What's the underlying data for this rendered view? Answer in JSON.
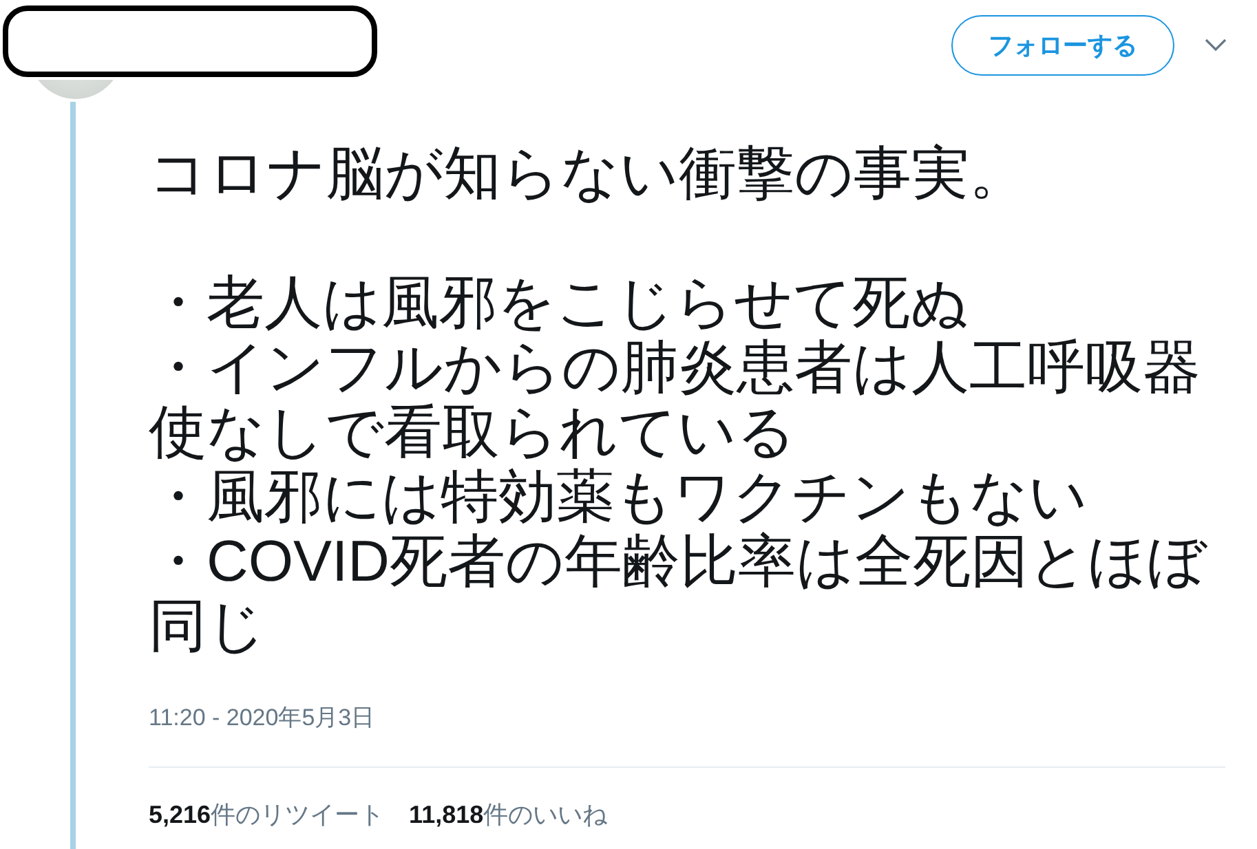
{
  "follow_button": {
    "label": "フォローする"
  },
  "tweet": {
    "headline": "コロナ脳が知らない衝撃の事実。",
    "points": [
      "・老人は風邪をこじらせて死ぬ",
      "・インフルからの肺炎患者は人工呼吸器使なしで看取られている",
      "・風邪には特効薬もワクチンもない",
      "・COVID死者の年齢比率は全死因とほぼ同じ"
    ],
    "timestamp": "11:20 - 2020年5月3日"
  },
  "stats": [
    {
      "text": "**5,216**件のリツイート"
    },
    {
      "text": "**11,818**件のいいね"
    }
  ]
}
